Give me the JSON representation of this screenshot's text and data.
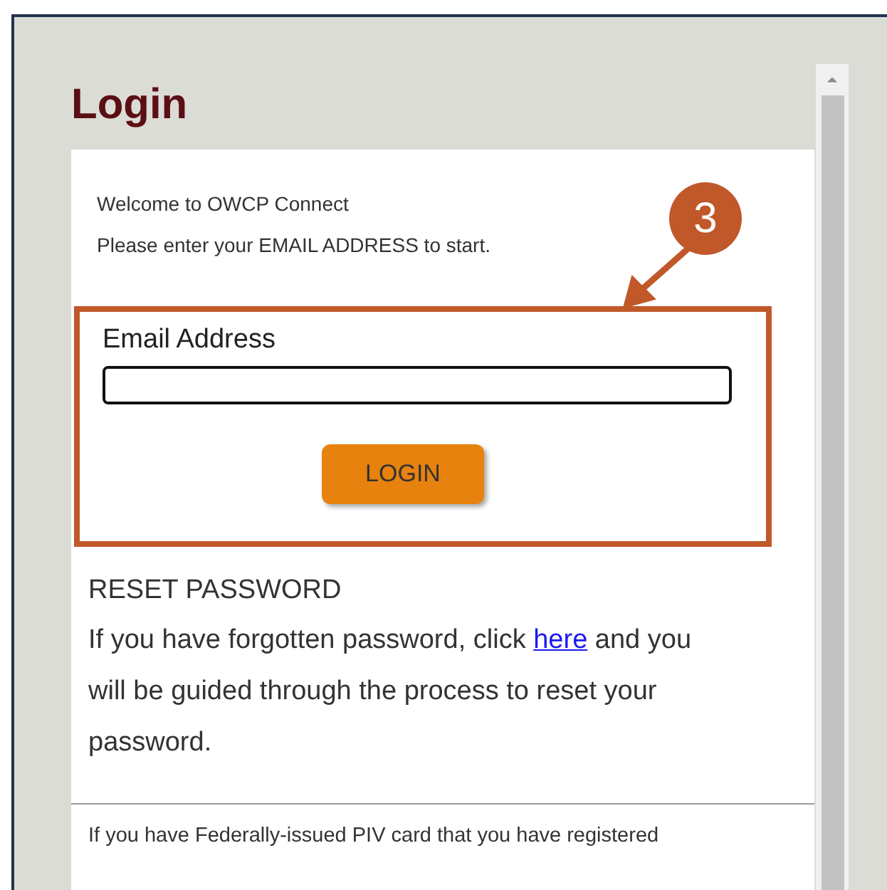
{
  "page": {
    "title": "Login"
  },
  "welcome": [
    "Welcome to OWCP Connect",
    "Please enter your EMAIL ADDRESS to start."
  ],
  "callout": {
    "number": "3"
  },
  "email_field": {
    "label": "Email Address"
  },
  "login_button": "LOGIN",
  "reset": {
    "heading": "RESET PASSWORD",
    "text_before": "If you have forgotten password, click",
    "link": "here",
    "text_after": "and you will be guided through the process to reset your password."
  },
  "piv_text": "If you have Federally-issued PIV card that you have registered"
}
